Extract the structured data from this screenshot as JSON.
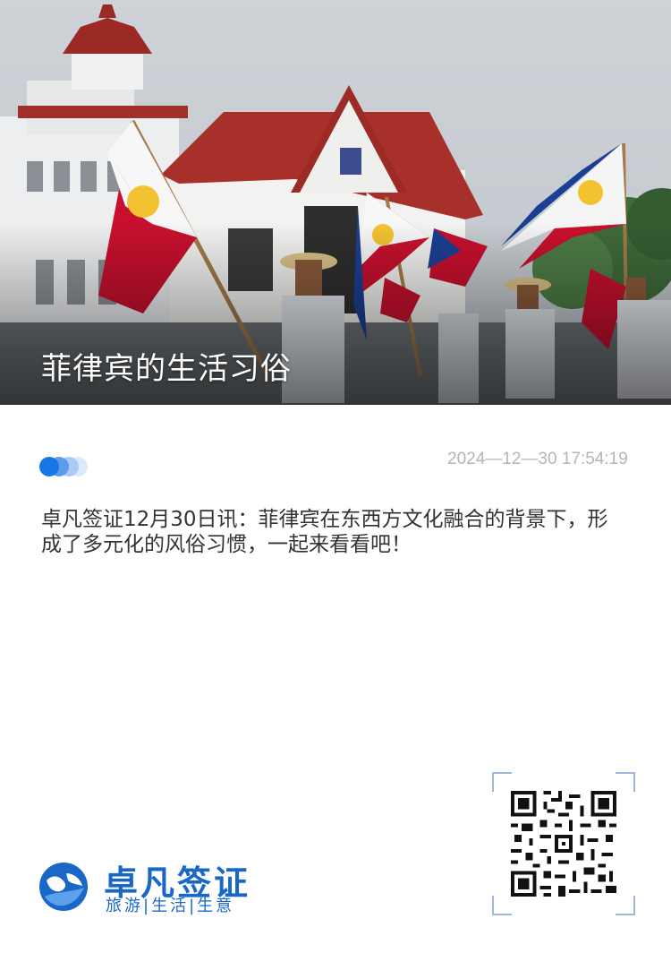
{
  "header": {
    "title": "菲律宾的生活习俗",
    "image_subject": "philippine-flags-parade-photo"
  },
  "meta": {
    "datetime": "2024—12—30 17:54:19"
  },
  "article": {
    "lead": "卓凡签证12月30日讯：菲律宾在东西方文化融合的背景下，形成了多元化的风俗习惯，一起来看看吧！"
  },
  "brand": {
    "name": "卓凡签证",
    "tagline": "旅游|生活|生意",
    "color": "#1967c7"
  },
  "qr": {
    "icon": "qr-code-icon"
  }
}
